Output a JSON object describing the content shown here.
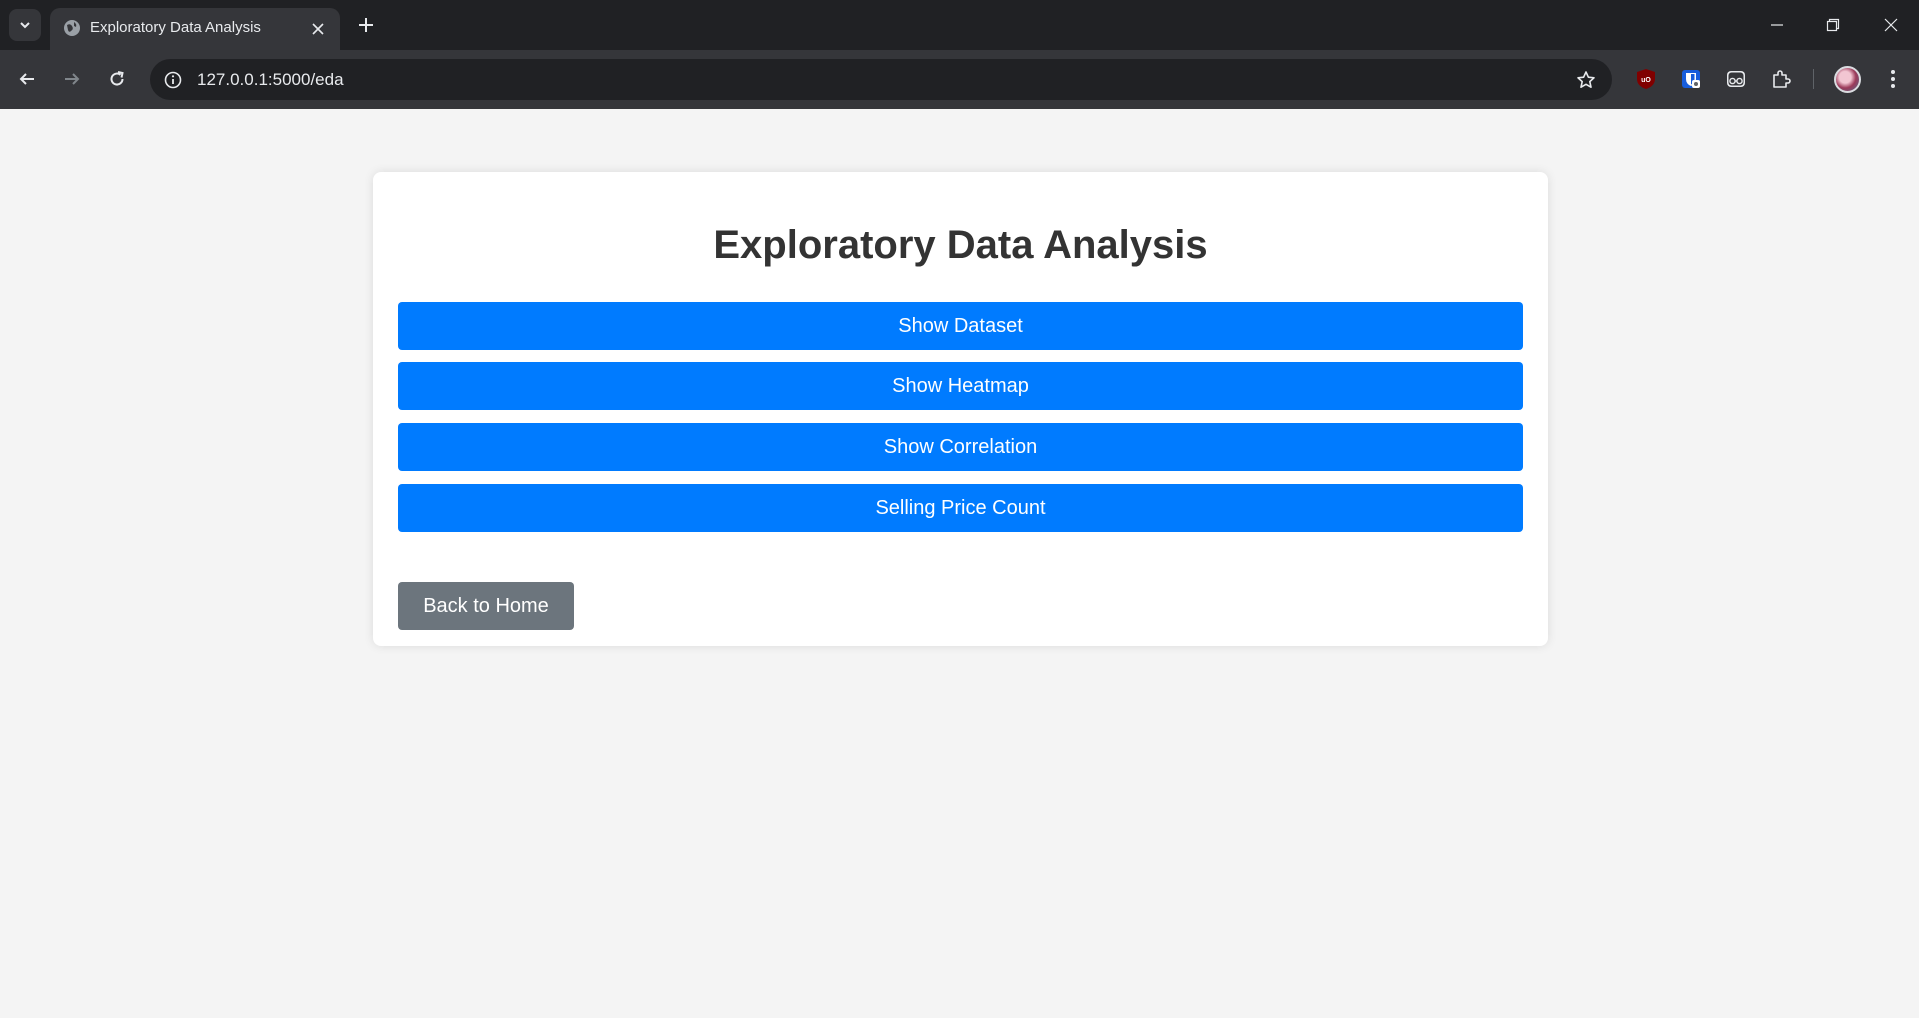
{
  "browser": {
    "tab_title": "Exploratory Data Analysis",
    "url": "127.0.0.1:5000/eda",
    "icons": {
      "tab_search": "chevron-down-icon",
      "favicon": "globe-icon",
      "tab_close": "close-icon",
      "new_tab": "plus-icon",
      "back": "arrow-left-icon",
      "forward": "arrow-right-icon",
      "reload": "reload-icon",
      "site_info": "info-icon",
      "bookmark": "star-icon",
      "extensions": "puzzle-icon",
      "menu": "kebab-menu-icon"
    },
    "extensions": [
      "ublock-origin",
      "bitwarden",
      "incognito-glasses"
    ]
  },
  "page": {
    "title": "Exploratory Data Analysis",
    "buttons": [
      {
        "label": "Show Dataset"
      },
      {
        "label": "Show Heatmap"
      },
      {
        "label": "Show Correlation"
      },
      {
        "label": "Selling Price Count"
      }
    ],
    "back_label": "Back to Home",
    "colors": {
      "primary": "#007bff",
      "secondary": "#6c757d",
      "background": "#f4f4f4",
      "card": "#ffffff",
      "title": "#333333"
    }
  }
}
